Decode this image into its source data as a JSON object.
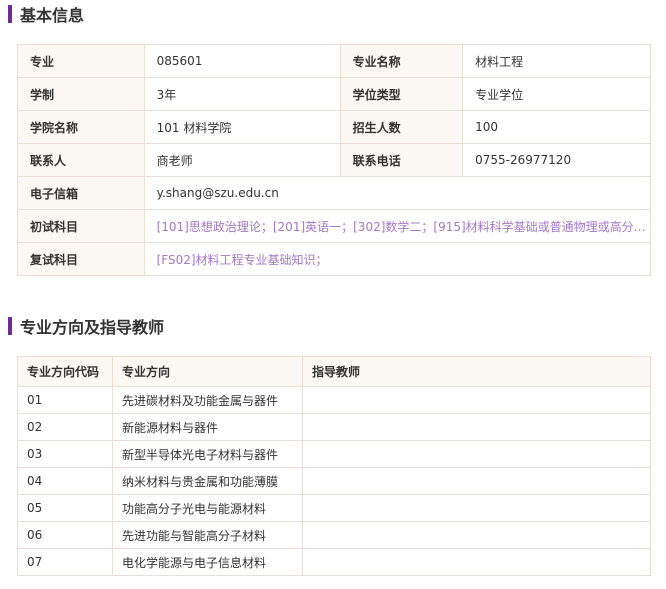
{
  "basic": {
    "title": "基本信息",
    "rows": [
      [
        {
          "label": "专业",
          "value": "085601"
        },
        {
          "label": "专业名称",
          "value": "材料工程"
        }
      ],
      [
        {
          "label": "学制",
          "value": "3年"
        },
        {
          "label": "学位类型",
          "value": "专业学位"
        }
      ],
      [
        {
          "label": "学院名称",
          "value": "101 材料学院"
        },
        {
          "label": "招生人数",
          "value": "100"
        }
      ],
      [
        {
          "label": "联系人",
          "value": "商老师"
        },
        {
          "label": "联系电话",
          "value": "0755-26977120"
        }
      ]
    ],
    "email": {
      "label": "电子信箱",
      "value": "y.shang@szu.edu.cn"
    },
    "exam1": {
      "label": "初试科目",
      "value": "[101]思想政治理论；[201]英语一；[302]数学二；[915]材料科学基础或普通物理或高分子…"
    },
    "exam2": {
      "label": "复试科目",
      "value": "[FS02]材料工程专业基础知识；"
    }
  },
  "directions": {
    "title": "专业方向及指导教师",
    "headers": [
      "专业方向代码",
      "专业方向",
      "指导教师"
    ],
    "rows": [
      {
        "code": "01",
        "name": "先进碳材料及功能金属与器件",
        "tutor": ""
      },
      {
        "code": "02",
        "name": "新能源材料与器件",
        "tutor": ""
      },
      {
        "code": "03",
        "name": "新型半导体光电子材料与器件",
        "tutor": ""
      },
      {
        "code": "04",
        "name": "纳米材料与贵金属和功能薄膜",
        "tutor": ""
      },
      {
        "code": "05",
        "name": "功能高分子光电与能源材料",
        "tutor": ""
      },
      {
        "code": "06",
        "name": "先进功能与智能高分子材料",
        "tutor": ""
      },
      {
        "code": "07",
        "name": "电化学能源与电子信息材料",
        "tutor": ""
      }
    ]
  },
  "colors": {
    "accent": "#6a2c91",
    "link": "#a378c6",
    "label_bg": "#fbf7f2",
    "border": "#eadfd3"
  }
}
